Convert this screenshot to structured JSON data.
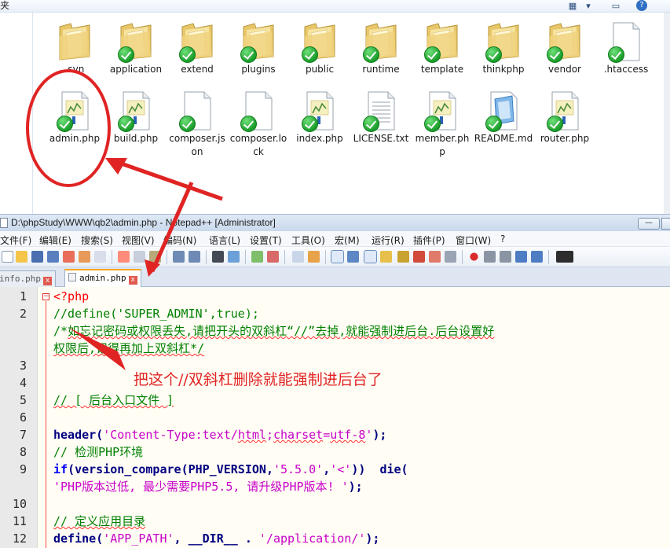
{
  "explorer": {
    "top_label": "夹",
    "row1": [
      {
        "name": ".svn",
        "icon": "folder-icon",
        "check": false
      },
      {
        "name": "application",
        "icon": "folder-icon",
        "check": true
      },
      {
        "name": "extend",
        "icon": "folder-icon",
        "check": true
      },
      {
        "name": "plugins",
        "icon": "folder-icon",
        "check": true
      },
      {
        "name": "public",
        "icon": "folder-icon",
        "check": true
      },
      {
        "name": "runtime",
        "icon": "folder-icon",
        "check": true
      },
      {
        "name": "template",
        "icon": "folder-icon",
        "check": true
      },
      {
        "name": "thinkphp",
        "icon": "folder-icon",
        "check": true
      },
      {
        "name": "vendor",
        "icon": "folder-icon",
        "check": true
      },
      {
        "name": ".htaccess",
        "icon": "file-icon",
        "check": true
      }
    ],
    "row2": [
      {
        "name": "admin.php",
        "icon": "php-file-icon",
        "check": true
      },
      {
        "name": "build.php",
        "icon": "php-file-icon",
        "check": true
      },
      {
        "name": "composer.json",
        "icon": "file-icon",
        "check": true
      },
      {
        "name": "composer.lock",
        "icon": "file-icon",
        "check": true
      },
      {
        "name": "index.php",
        "icon": "php-file-icon",
        "check": true
      },
      {
        "name": "LICENSE.txt",
        "icon": "text-file-icon",
        "check": true
      },
      {
        "name": "member.php",
        "icon": "php-file-icon",
        "check": true
      },
      {
        "name": "README.md",
        "icon": "readme-file-icon",
        "check": true
      },
      {
        "name": "router.php",
        "icon": "php-file-icon",
        "check": true
      }
    ]
  },
  "notepad": {
    "title": "D:\\phpStudy\\WWW\\qb2\\admin.php - Notepad++ [Administrator]",
    "min_label": "—",
    "menu": [
      "文件(F)",
      "编辑(E)",
      "搜索(S)",
      "视图(V)",
      "编码(N)",
      "语言(L)",
      "设置(T)",
      "工具(O)",
      "宏(M)",
      "运行(R)",
      "插件(P)",
      "窗口(W)",
      "?"
    ],
    "tabs": [
      {
        "label": "info.php",
        "close": "x",
        "active": false
      },
      {
        "label": "admin.php",
        "close": "x",
        "active": true
      }
    ],
    "line_numbers": [
      "1",
      "2",
      "",
      "",
      "3",
      "4",
      "5",
      "6",
      "7",
      "8",
      "9",
      "",
      "10",
      "11",
      "12"
    ],
    "code": {
      "l1": "<?php",
      "l2": "//define('SUPER_ADMIN',true);",
      "l2b_prefix": "/*",
      "l2b": "如忘记密码或权限丢失,请把开头的双斜杠“//”去掉,就能强制进后台.后台设置好",
      "l2c": "权限后,记得再加上双斜杠*/",
      "l5": "// [ 后台入口文件 ]",
      "l7_fn": "header",
      "l7_open": "(",
      "l7_str_a": "'Content-Type:text/",
      "l7_html": "html",
      "l7_semi": ";",
      "l7_charset": "charset",
      "l7_eq": "=",
      "l7_utf": "utf-8",
      "l7_str_b": "'",
      "l7_close": ");",
      "l8": "// 检测PHP环境",
      "l9_kw": "if",
      "l9_open": "(",
      "l9_fn": "version_compare",
      "l9_p1": "(",
      "l9_const": "PHP_VERSION",
      "l9_comma1": ",",
      "l9_ver": "'5.5.0'",
      "l9_comma2": ",",
      "l9_lt": "'<'",
      "l9_close": "))",
      "l9_gap": "  ",
      "l9_die": "die",
      "l9_p2": "(",
      "l9b_str": "'PHP版本过低, 最少需要PHP5.5, 请升级PHP版本! '",
      "l9b_end": ");",
      "l11": "// 定义应用目录",
      "l12_fn": "define",
      "l12_open": "(",
      "l12_str1": "'APP_PATH'",
      "l12_comma": ", ",
      "l12_dir": "__DIR__",
      "l12_dot": " . ",
      "l12_str2": "'/application/'",
      "l12_end": ");"
    },
    "annotation": "把这个//双斜杠删除就能强制进后台了"
  },
  "colors": {
    "annotation_red": "#e02424",
    "comment_green": "#008000",
    "string_magenta": "#c800c8",
    "keyword_blue": "#0000ff",
    "php_tag_red": "#ff0000"
  }
}
